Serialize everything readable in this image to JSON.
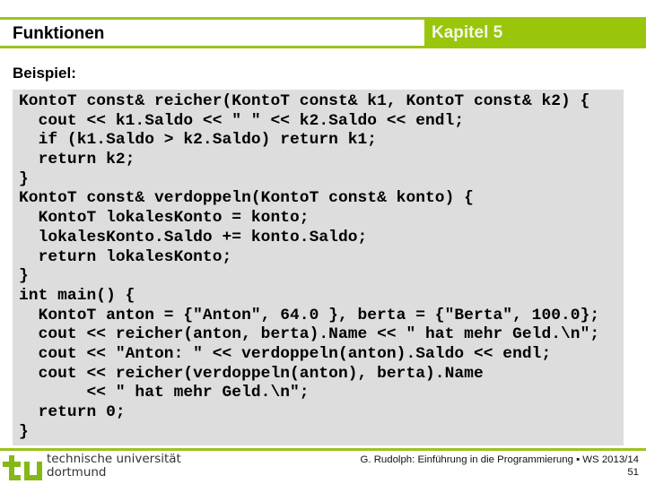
{
  "header": {
    "title": "Funktionen",
    "chapter": "Kapitel 5",
    "accent_color": "#99c60a"
  },
  "section": {
    "label": "Beispiel:"
  },
  "code": {
    "language": "C++",
    "lines": [
      "KontoT const& reicher(KontoT const& k1, KontoT const& k2) {",
      "  cout << k1.Saldo << \" \" << k2.Saldo << endl;",
      "  if (k1.Saldo > k2.Saldo) return k1;",
      "  return k2;",
      "}",
      "KontoT const& verdoppeln(KontoT const& konto) {",
      "  KontoT lokalesKonto = konto;",
      "  lokalesKonto.Saldo += konto.Saldo;",
      "  return lokalesKonto;",
      "}",
      "int main() {",
      "  KontoT anton = {\"Anton\", 64.0 }, berta = {\"Berta\", 100.0};",
      "  cout << reicher(anton, berta).Name << \" hat mehr Geld.\\n\";",
      "  cout << \"Anton: \" << verdoppeln(anton).Saldo << endl;",
      "  cout << reicher(verdoppeln(anton), berta).Name",
      "       << \" hat mehr Geld.\\n\";",
      "  return 0;",
      "}"
    ]
  },
  "footer": {
    "logo_icon": "tu-logo-icon",
    "university_line1": "technische universität",
    "university_line2": "dortmund",
    "credit": "G. Rudolph: Einführung in die Programmierung ▪ WS 2013/14",
    "page_number": "51"
  }
}
